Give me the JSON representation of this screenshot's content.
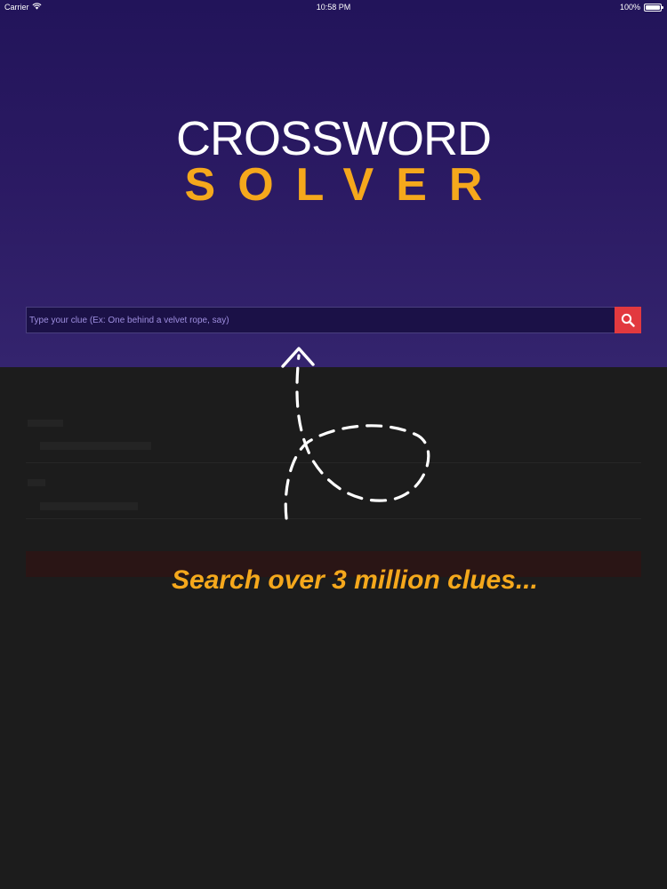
{
  "status_bar": {
    "carrier": "Carrier",
    "time": "10:58 PM",
    "battery": "100%",
    "wifi_icon": "wifi-icon",
    "battery_icon": "battery-icon"
  },
  "logo": {
    "line1": "CROSSWORD",
    "line2": "SOLVER"
  },
  "search": {
    "placeholder": "Type your clue (Ex: One behind a velvet rope, say)",
    "value": "",
    "button_icon": "search-icon"
  },
  "overlay": {
    "tip": "Search over 3 million clues..."
  },
  "colors": {
    "hero_top": "#22145a",
    "hero_bottom": "#34246e",
    "accent_orange": "#f5a81c",
    "search_button": "#e2393f",
    "overlay_background": "#1c1c1c"
  }
}
